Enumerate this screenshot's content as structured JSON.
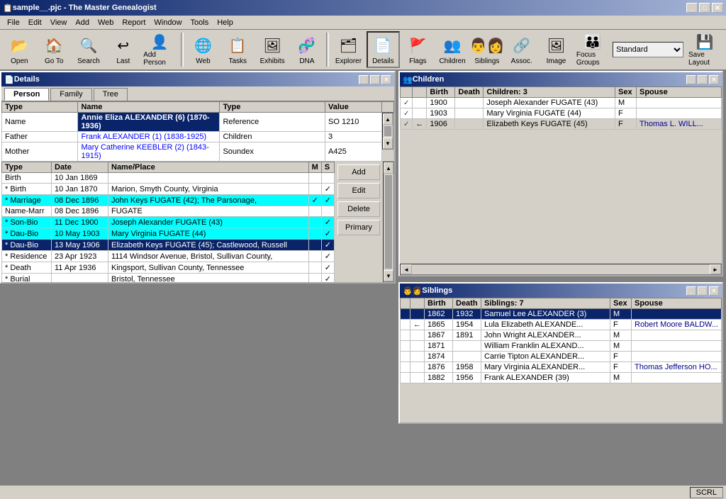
{
  "window": {
    "title": "sample__.pjc - The Master Genealogist",
    "icon": "📋"
  },
  "menu": {
    "items": [
      "File",
      "Edit",
      "View",
      "Add",
      "Web",
      "Report",
      "Window",
      "Tools",
      "Help"
    ]
  },
  "toolbar": {
    "buttons": [
      {
        "id": "open",
        "label": "Open",
        "icon": "📂"
      },
      {
        "id": "goto",
        "label": "Go To",
        "icon": "🏠"
      },
      {
        "id": "search",
        "label": "Search",
        "icon": "🔍"
      },
      {
        "id": "last",
        "label": "Last",
        "icon": "↩"
      },
      {
        "id": "add-person",
        "label": "Add Person",
        "icon": "👤"
      },
      {
        "id": "web",
        "label": "Web",
        "icon": "🌐"
      },
      {
        "id": "tasks",
        "label": "Tasks",
        "icon": "📋"
      },
      {
        "id": "exhibits",
        "label": "Exhibits",
        "icon": "🖼"
      },
      {
        "id": "dna",
        "label": "DNA",
        "icon": "🧬"
      },
      {
        "id": "explorer",
        "label": "Explorer",
        "icon": "🗂"
      },
      {
        "id": "details",
        "label": "Details",
        "icon": "📄"
      },
      {
        "id": "flags",
        "label": "Flags",
        "icon": "🚩"
      },
      {
        "id": "children",
        "label": "Children",
        "icon": "👥"
      },
      {
        "id": "siblings",
        "label": "Siblings",
        "icon": "👨‍👩"
      },
      {
        "id": "assoc",
        "label": "Assoc.",
        "icon": "🔗"
      },
      {
        "id": "image",
        "label": "Image",
        "icon": "🖼"
      },
      {
        "id": "focus-groups",
        "label": "Focus Groups",
        "icon": "👪"
      },
      {
        "id": "save-layout",
        "label": "Save Layout",
        "icon": "💾"
      }
    ],
    "layout_value": "Standard"
  },
  "details_panel": {
    "title": "Details",
    "tabs": [
      "Person",
      "Family",
      "Tree"
    ],
    "active_tab": "Person",
    "info_rows": [
      {
        "type": "Name",
        "name": "Annie Eliza ALEXANDER (6) (1870-1936)",
        "ref_type": "Reference",
        "value": "SO 1210"
      },
      {
        "type": "Father",
        "name": "Frank ALEXANDER (1) (1838-1925)",
        "ref_type": "Children",
        "value": "3"
      },
      {
        "type": "Mother",
        "name": "Mary Catherine KEEBLER (2) (1843-1915)",
        "ref_type": "Soundex",
        "value": "A425"
      }
    ],
    "events_header": [
      "Type",
      "Date",
      "Name/Place",
      "M",
      "S"
    ],
    "events": [
      {
        "type": "Birth",
        "date": "10 Jan 1869",
        "place": "",
        "m": "",
        "s": ""
      },
      {
        "type": "* Birth",
        "date": "10 Jan 1870",
        "place": "Marion, Smyth County, Virginia",
        "m": "",
        "s": "✓"
      },
      {
        "type": "* Marriage",
        "date": "08 Dec 1896",
        "place": "John Keys FUGATE (42); The Parsonage,",
        "m": "✓",
        "s": "✓",
        "highlight": true
      },
      {
        "type": "Name-Marr",
        "date": "08 Dec 1896",
        "place": "FUGATE",
        "m": "",
        "s": ""
      },
      {
        "type": "* Son-Bio",
        "date": "11 Dec 1900",
        "place": "Joseph Alexander FUGATE (43)",
        "m": "",
        "s": "✓",
        "highlight2": true
      },
      {
        "type": "* Dau-Bio",
        "date": "10 May 1903",
        "place": "Mary Virginia FUGATE (44)",
        "m": "",
        "s": "✓",
        "highlight2": true
      },
      {
        "type": "* Dau-Bio",
        "date": "13 May 1906",
        "place": "Elizabeth Keys FUGATE (45); Castlewood, Russell",
        "m": "",
        "s": "✓",
        "selected": true
      },
      {
        "type": "* Residence",
        "date": "23 Apr 1923",
        "place": "1114 Windsor Avenue, Bristol, Sullivan County,",
        "m": "",
        "s": "✓"
      },
      {
        "type": "* Death",
        "date": "11 Apr 1936",
        "place": "Kingsport, Sullivan County, Tennessee",
        "m": "",
        "s": "✓"
      },
      {
        "type": "* Burial",
        "date": "__ ___ ____",
        "place": "Bristol, Tennessee",
        "m": "",
        "s": "✓"
      }
    ]
  },
  "children_panel": {
    "title": "Children",
    "count_label": "Children: 3",
    "columns": [
      "Birth",
      "Death",
      "Children: 3",
      "Sex",
      "Spouse"
    ],
    "rows": [
      {
        "check": "✓",
        "arrow": "",
        "birth": "1900",
        "death": "",
        "name": "Joseph Alexander FUGATE (43)",
        "sex": "M",
        "spouse": ""
      },
      {
        "check": "✓",
        "arrow": "",
        "birth": "1903",
        "death": "",
        "name": "Mary Virginia FUGATE (44)",
        "sex": "F",
        "spouse": ""
      },
      {
        "check": "✓",
        "arrow": "←",
        "birth": "1906",
        "death": "",
        "name": "Elizabeth Keys FUGATE (45)",
        "sex": "F",
        "spouse": "Thomas L. WILL..."
      }
    ]
  },
  "siblings_panel": {
    "title": "Siblings",
    "count_label": "Siblings: 7",
    "columns": [
      "Birth",
      "Death",
      "Siblings: 7",
      "Sex",
      "Spouse"
    ],
    "rows": [
      {
        "check": "",
        "arrow": "",
        "birth": "1862",
        "death": "1932",
        "name": "Samuel Lee ALEXANDER (3)",
        "sex": "M",
        "spouse": "",
        "selected": true
      },
      {
        "check": "",
        "arrow": "←",
        "birth": "1865",
        "death": "1954",
        "name": "Lula Elizabeth ALEXANDE...",
        "sex": "F",
        "spouse": "Robert Moore BALDW..."
      },
      {
        "check": "",
        "arrow": "",
        "birth": "1867",
        "death": "1891",
        "name": "John Wright ALEXANDER...",
        "sex": "M",
        "spouse": ""
      },
      {
        "check": "",
        "arrow": "",
        "birth": "1871",
        "death": "",
        "name": "William Franklin ALEXAND...",
        "sex": "M",
        "spouse": ""
      },
      {
        "check": "",
        "arrow": "",
        "birth": "1874",
        "death": "",
        "name": "Carrie Tipton ALEXANDER...",
        "sex": "F",
        "spouse": ""
      },
      {
        "check": "",
        "arrow": "",
        "birth": "1876",
        "death": "1958",
        "name": "Mary Virginia ALEXANDER...",
        "sex": "F",
        "spouse": "Thomas Jefferson HO..."
      },
      {
        "check": "",
        "arrow": "",
        "birth": "1882",
        "death": "1956",
        "name": "Frank ALEXANDER (39)",
        "sex": "M",
        "spouse": ""
      }
    ]
  },
  "status_bar": {
    "item": "SCRL"
  }
}
